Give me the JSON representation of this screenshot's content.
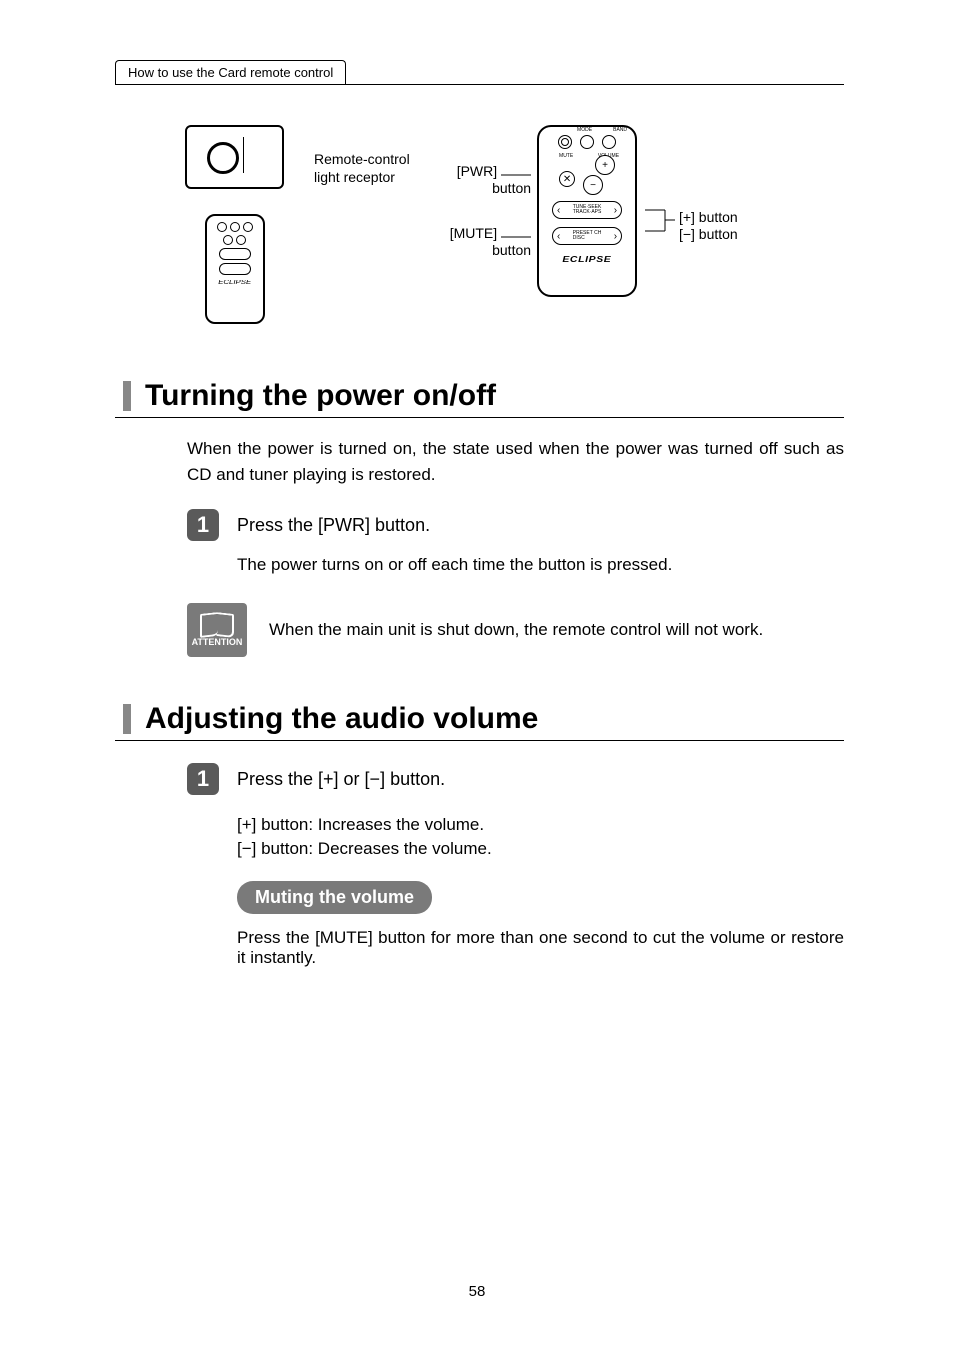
{
  "header": {
    "breadcrumb": "How to use the Card remote control"
  },
  "diagram": {
    "receptor_label_line1": "Remote-control",
    "receptor_label_line2": "light receptor",
    "pwr_callout_line1": "[PWR]",
    "pwr_callout_line2": "button",
    "mute_callout_line1": "[MUTE]",
    "mute_callout_line2": "button",
    "plus_callout": "[+] button",
    "minus_callout": "[−] button",
    "remote_labels": {
      "mode": "MODE",
      "band": "BAND",
      "mute": "MUTE",
      "volume": "VOLUME",
      "tune_seek": "TUNE·SEEK",
      "track_aps": "TRACK·APS",
      "preset_ch": "PRESET CH",
      "disc": "DISC",
      "pwr": "PWR",
      "brand": "ECLIPSE"
    }
  },
  "section1": {
    "heading": "Turning the power on/off",
    "intro": "When the power is turned on, the state used when the power was turned off such as CD and tuner playing is restored.",
    "step1_num": "1",
    "step1_text": "Press the [PWR] button.",
    "step1_sub": "The power turns on or off each time the button is pressed.",
    "attention_label": "ATTENTION",
    "attention_text": "When the main unit is shut down, the remote control will not work."
  },
  "section2": {
    "heading": "Adjusting the audio volume",
    "step1_num": "1",
    "step1_text": "Press the [+] or [−] button.",
    "plus_line": "[+] button:  Increases the volume.",
    "minus_line": "[−] button:  Decreases the volume.",
    "sub_heading": "Muting the volume",
    "mute_text": "Press the [MUTE] button for more than one second to cut the volume or restore it instantly."
  },
  "footer": {
    "page": "58"
  }
}
